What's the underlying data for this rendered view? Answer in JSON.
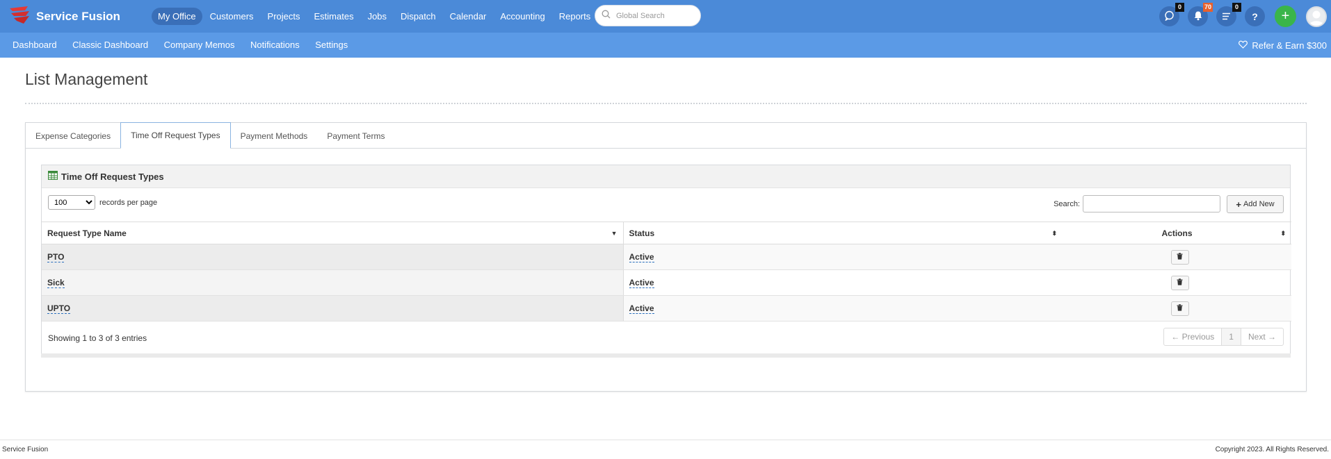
{
  "app": {
    "name": "Service Fusion",
    "brand_color": "#4b8ad8",
    "subbar_color": "#5b9ae6",
    "logo_icon": "service-fusion-logo-icon"
  },
  "main_nav": {
    "items": [
      {
        "label": "My Office",
        "active": true
      },
      {
        "label": "Customers"
      },
      {
        "label": "Projects"
      },
      {
        "label": "Estimates"
      },
      {
        "label": "Jobs"
      },
      {
        "label": "Dispatch"
      },
      {
        "label": "Calendar"
      },
      {
        "label": "Accounting"
      },
      {
        "label": "Reports"
      }
    ]
  },
  "global_search": {
    "placeholder": "Global Search",
    "icon": "search-icon"
  },
  "header_icons": {
    "chat": {
      "icon": "chat-icon",
      "count": "0"
    },
    "notifications": {
      "icon": "bell-icon",
      "count": "70",
      "badge_color": "#e8602c"
    },
    "tasks": {
      "icon": "list-icon",
      "count": "0"
    },
    "help": {
      "label": "?",
      "icon": "help-icon"
    },
    "add": {
      "label": "+",
      "icon": "plus-icon",
      "color": "#3ab54a"
    },
    "avatar": {
      "icon": "user-avatar-icon"
    }
  },
  "sub_nav": {
    "items": [
      {
        "label": "Dashboard"
      },
      {
        "label": "Classic Dashboard"
      },
      {
        "label": "Company Memos"
      },
      {
        "label": "Notifications"
      },
      {
        "label": "Settings"
      }
    ],
    "refer": {
      "label": "Refer & Earn $300",
      "icon": "heart-icon"
    }
  },
  "page": {
    "title": "List Management"
  },
  "tabs": [
    {
      "label": "Expense Categories"
    },
    {
      "label": "Time Off Request Types",
      "active": true
    },
    {
      "label": "Payment Methods"
    },
    {
      "label": "Payment Terms"
    }
  ],
  "widget": {
    "title": "Time Off Request Types",
    "icon": "table-icon",
    "length_value": "100",
    "length_options": [
      "100"
    ],
    "length_suffix": "records per page",
    "search_label": "Search:",
    "search_value": "",
    "add_new_label": "Add New",
    "columns": [
      {
        "label": "Request Type Name",
        "sort": "desc"
      },
      {
        "label": "Status",
        "sort": "both"
      },
      {
        "label": "Actions",
        "sort": "both"
      }
    ],
    "rows": [
      {
        "name": "PTO",
        "status": "Active",
        "action_icon": "trash-icon"
      },
      {
        "name": "Sick",
        "status": "Active",
        "action_icon": "trash-icon"
      },
      {
        "name": "UPTO",
        "status": "Active",
        "action_icon": "trash-icon"
      }
    ],
    "info": "Showing 1 to 3 of 3 entries",
    "pager": {
      "prev": "← Previous",
      "current": "1",
      "next": "Next →"
    }
  },
  "footer": {
    "left": "Service Fusion",
    "right": "Copyright 2023. All Rights Reserved."
  }
}
